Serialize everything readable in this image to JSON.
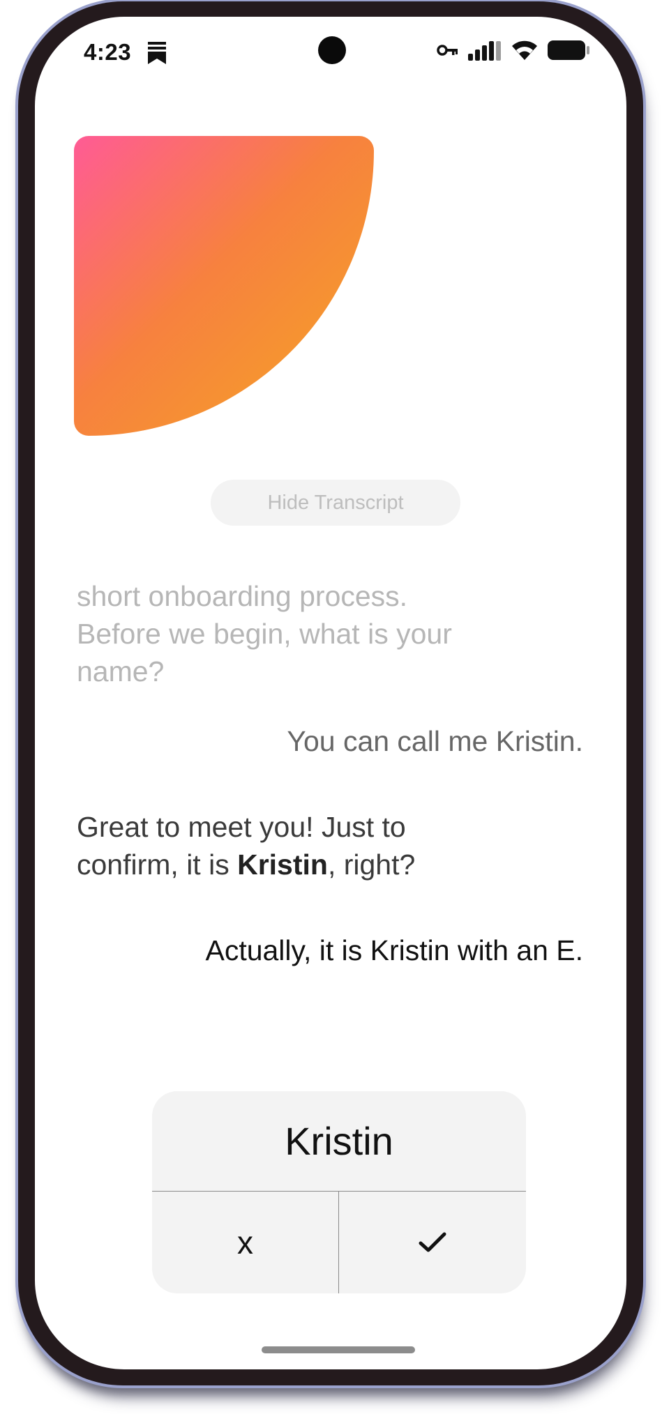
{
  "status_bar": {
    "time": "4:23",
    "icons": [
      "bookmark-icon",
      "key-icon",
      "signal-icon",
      "wifi-icon",
      "battery-icon"
    ]
  },
  "visual": {
    "gradient_colors": [
      "#ff5b95",
      "#f7813f",
      "#f4a623"
    ]
  },
  "transcript": {
    "toggle_label": "Hide Transcript",
    "messages": [
      {
        "role": "assistant",
        "text": "short onboarding process. Before we begin, what is your name?"
      },
      {
        "role": "user",
        "text": "You can call me Kristin."
      },
      {
        "role": "assistant",
        "text_before": "Great to meet you! Just to confirm, it is ",
        "highlight": "Kristin",
        "text_after": ", right?"
      },
      {
        "role": "user",
        "text": "Actually, it is Kristin with an E."
      }
    ]
  },
  "confirm_card": {
    "name": "Kristin",
    "reject_label": "x",
    "accept_icon": "checkmark-icon"
  }
}
